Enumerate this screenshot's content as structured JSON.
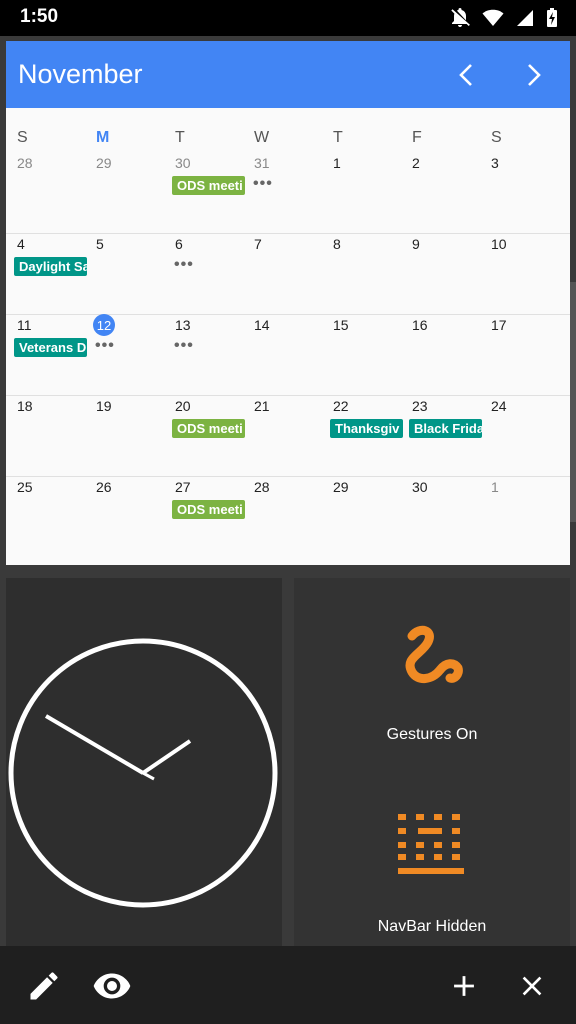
{
  "status_bar": {
    "time": "1:50",
    "icons": [
      "notifications-off-icon",
      "wifi-icon",
      "signal-icon",
      "battery-charging-icon"
    ]
  },
  "calendar": {
    "month": "November",
    "weekdays": [
      "S",
      "M",
      "T",
      "W",
      "T",
      "F",
      "S"
    ],
    "today_weekday_index": 1,
    "weeks": [
      [
        "28",
        "29",
        "30",
        "31",
        "1",
        "2",
        "3"
      ],
      [
        "4",
        "5",
        "6",
        "7",
        "8",
        "9",
        "10"
      ],
      [
        "11",
        "12",
        "13",
        "14",
        "15",
        "16",
        "17"
      ],
      [
        "18",
        "19",
        "20",
        "21",
        "22",
        "23",
        "24"
      ],
      [
        "25",
        "26",
        "27",
        "28",
        "29",
        "30",
        "1"
      ]
    ],
    "today": "12",
    "events": {
      "ods_1": "ODS meeti",
      "daylight": "Daylight Sa",
      "veterans": "Veterans D",
      "ods_2": "ODS meeti",
      "thanksgiving": "Thanksgiv",
      "black_friday": "Black Frida",
      "ods_3": "ODS meeti"
    },
    "more_indicator": "•••",
    "colors": {
      "header": "#4285f4",
      "green_event": "#7cb342",
      "teal_event": "#009688"
    }
  },
  "tiles": {
    "gestures_label": "Gestures On",
    "navbar_label": "NavBar Hidden",
    "accent_color": "#f08a24"
  },
  "bottom_bar": {
    "icons": [
      "edit-icon",
      "eye-icon",
      "add-icon",
      "close-icon"
    ]
  }
}
